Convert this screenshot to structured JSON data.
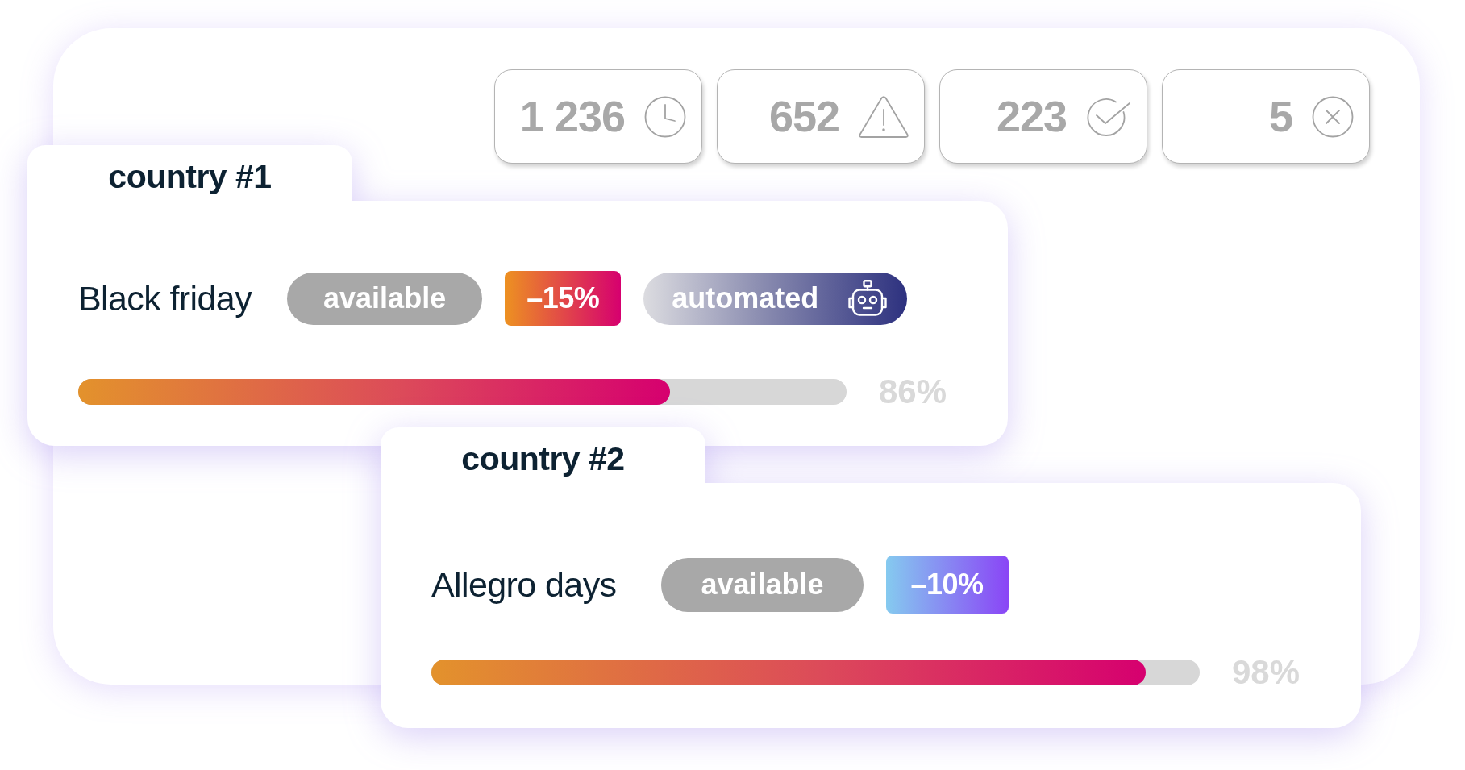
{
  "stats": [
    {
      "kind": "pending",
      "value": "1 236"
    },
    {
      "kind": "warning",
      "value": "652"
    },
    {
      "kind": "done",
      "value": "223"
    },
    {
      "kind": "failed",
      "value": "5"
    }
  ],
  "countries": [
    {
      "tab": "country #1",
      "campaign": "Black friday",
      "badges": [
        {
          "kind": "status",
          "label": "available"
        },
        {
          "kind": "discount",
          "label": "–15%",
          "color": "#d6006f"
        },
        {
          "kind": "automation",
          "label": "automated"
        }
      ],
      "progress": {
        "level": 0.77,
        "reading": "86%"
      }
    },
    {
      "tab": "country #2",
      "campaign": "Allegro days",
      "badges": [
        {
          "kind": "status",
          "label": "available"
        },
        {
          "kind": "discount",
          "label": "–10%",
          "color": "#8a45f6"
        }
      ],
      "progress": {
        "level": 0.93,
        "reading": "98%"
      }
    }
  ]
}
